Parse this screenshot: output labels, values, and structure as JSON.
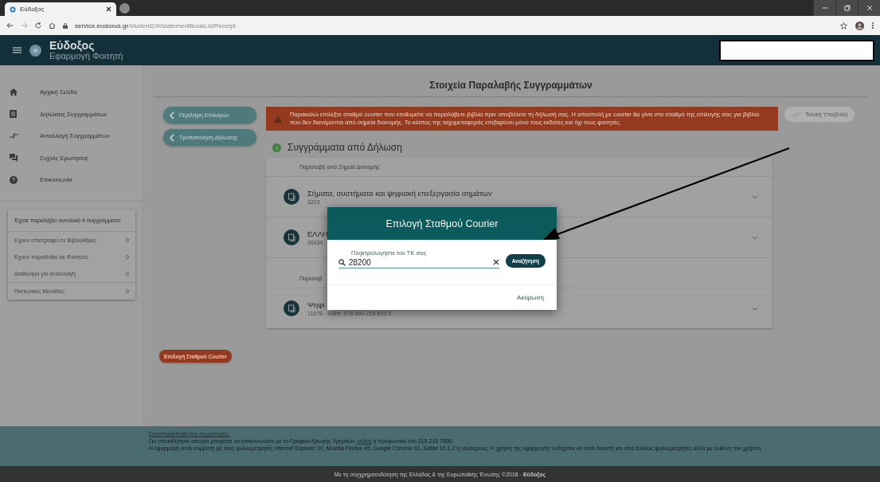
{
  "browser": {
    "tab_title": "Εύδοξος",
    "url_host": "service.eudoxus.gr",
    "url_path": "/student2/#/statementBookListReceipt"
  },
  "app_header": {
    "title": "Εύδοξος",
    "subtitle": "Εφαρμογή Φοιτητή"
  },
  "sidebar": {
    "items": [
      {
        "label": "Αρχική Σελίδα",
        "kind": "home"
      },
      {
        "label": "Δηλώσεις Συγγραμμάτων",
        "kind": "list"
      },
      {
        "label": "Ανταλλαγή Συγγραμμάτων",
        "kind": "swap"
      },
      {
        "label": "Συχνές Ερωτήσεις",
        "kind": "chat"
      },
      {
        "label": "Επικοινωνία",
        "kind": "help"
      }
    ],
    "stats": {
      "heading": "Έχετε παραλάβει συνολικά 4 συγγράμματα:",
      "rows": [
        {
          "label": "Εχουν επιστραφεί σε Βιβλιοθήκες",
          "value": "0"
        },
        {
          "label": "Εχουν παραδοθεί σε Φοιτητές",
          "value": "0"
        },
        {
          "label": "Διαθέσιμα για ανταλλαγή",
          "value": "0"
        },
        {
          "label": "Πιστωτικές Μονάδες",
          "value": "0"
        }
      ]
    }
  },
  "main": {
    "title": "Στοιχεία Παραλαβής Συγγραμμάτων",
    "nav_buttons": [
      "Περίληψη Επιλογών",
      "Τροποποίηση Δήλωσης"
    ],
    "submit_button": {
      "label": "Τελική Υποβολή",
      "disabled": true
    },
    "alert": "Παρακαλώ επιλέξτε σταθμό courier που επιθυμείτε να παραλάβετε βιβλία πριν υποβάλετε τη δήλωσή σας. Η αποστολή με courier θα γίνει στο σταθμό της επιλογής σας για βιβλία που δεν διανέμονται από σημεία διανομής. Το κόστος της ταχυμεταφοράς επιβαρύνει μόνο τους εκδότες και όχι τους φοιτητές.",
    "section_title": "Συγγράμματα από Δήλωση",
    "groups": [
      {
        "heading": "Παραλαβή από Σημεία Διανομής",
        "books": [
          {
            "title": "Σήματα, συστήματα και ψηφιακή επεξεργασία σημάτων",
            "code": "3223"
          },
          {
            "title": "ΕΛΛΗ",
            "code": "26434"
          }
        ]
      },
      {
        "heading": "Παραλαβ",
        "books": [
          {
            "title": "Ψηφι",
            "code": "11878 - ISBN: 978-960-218-693-0"
          }
        ]
      }
    ],
    "courier_button": "Επιλογή Σταθμού Courier"
  },
  "modal": {
    "title": "Επιλογή Σταθμού Courier",
    "field": {
      "label": "Πληκτρολογήστε τον ΤΚ σας",
      "value": "28200"
    },
    "search_button": "Αναζήτηση",
    "cancel_button": "Ακύρωση"
  },
  "footer": {
    "terms_link": "Όροι/προϋποθέσεις συμμετοχής.",
    "contact": {
      "before": "Για οποιαδήποτε απορία μπορείτε να επικοινωνείτε με το Γραφείο Αρωγής Χρηστών ",
      "link": "online",
      "after": " ή τηλεφωνικά στο 215 215 7850."
    },
    "compat": "Η εφαρμογή είναι συμβατή με τους φυλλομετρητές Internet Explorer 10, Mozilla Firefox 45, Google Chrome 61, Safari 10.1.2 ή νεώτερους. Η χρήση της εφαρμογής ενδέχεται να είναι δυνατή και από άλλους φυλλομετρητές αλλά με ευθύνη του χρήστη.",
    "credit": "Με τη συγχρηματοδότηση της Ελλάδας & της Ευρωπαϊκής Ένωσης ©2018 - **Εύδοξος**"
  }
}
